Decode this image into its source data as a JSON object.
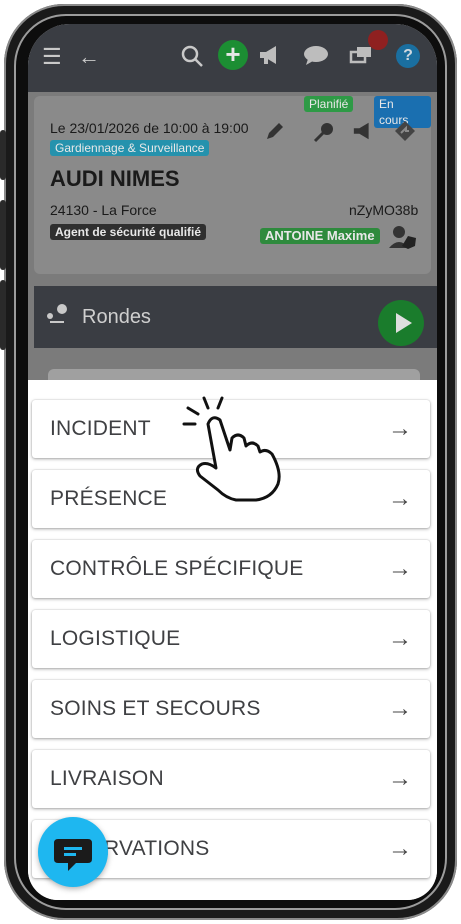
{
  "topbar": {
    "menu_icon": "hamburger-icon",
    "back_icon": "arrow-left-icon",
    "search_icon": "search-icon",
    "add_icon": "plus-icon",
    "megaphone_icon": "megaphone-icon",
    "chat_icon": "chat-icon",
    "transfer_icon": "transfer-icon",
    "help_label": "?"
  },
  "mission": {
    "status_planned": "Planifié",
    "status_in_progress": "En cours",
    "datetime": "Le 23/01/2026 de 10:00 à 19:00",
    "category": "Gardiennage & Surveillance",
    "site_name": "AUDI NIMES",
    "location": "24130 - La Force",
    "code": "nZyMO38b",
    "role": "Agent de sécurité qualifié",
    "agent": "ANTOINE Maxime"
  },
  "rondes": {
    "label": "Rondes"
  },
  "menu": {
    "items": [
      {
        "label": "INCIDENT"
      },
      {
        "label": "PRÉSENCE"
      },
      {
        "label": "CONTRÔLE SPÉCIFIQUE"
      },
      {
        "label": "LOGISTIQUE"
      },
      {
        "label": "SOINS ET SECOURS"
      },
      {
        "label": "LIVRAISON"
      },
      {
        "label": "RVATIONS"
      }
    ],
    "arrow": "→"
  },
  "colors": {
    "fab": "#1eb7f0",
    "planned": "#2e9a46",
    "in_progress": "#1a6fb0",
    "category": "#2592ad"
  }
}
